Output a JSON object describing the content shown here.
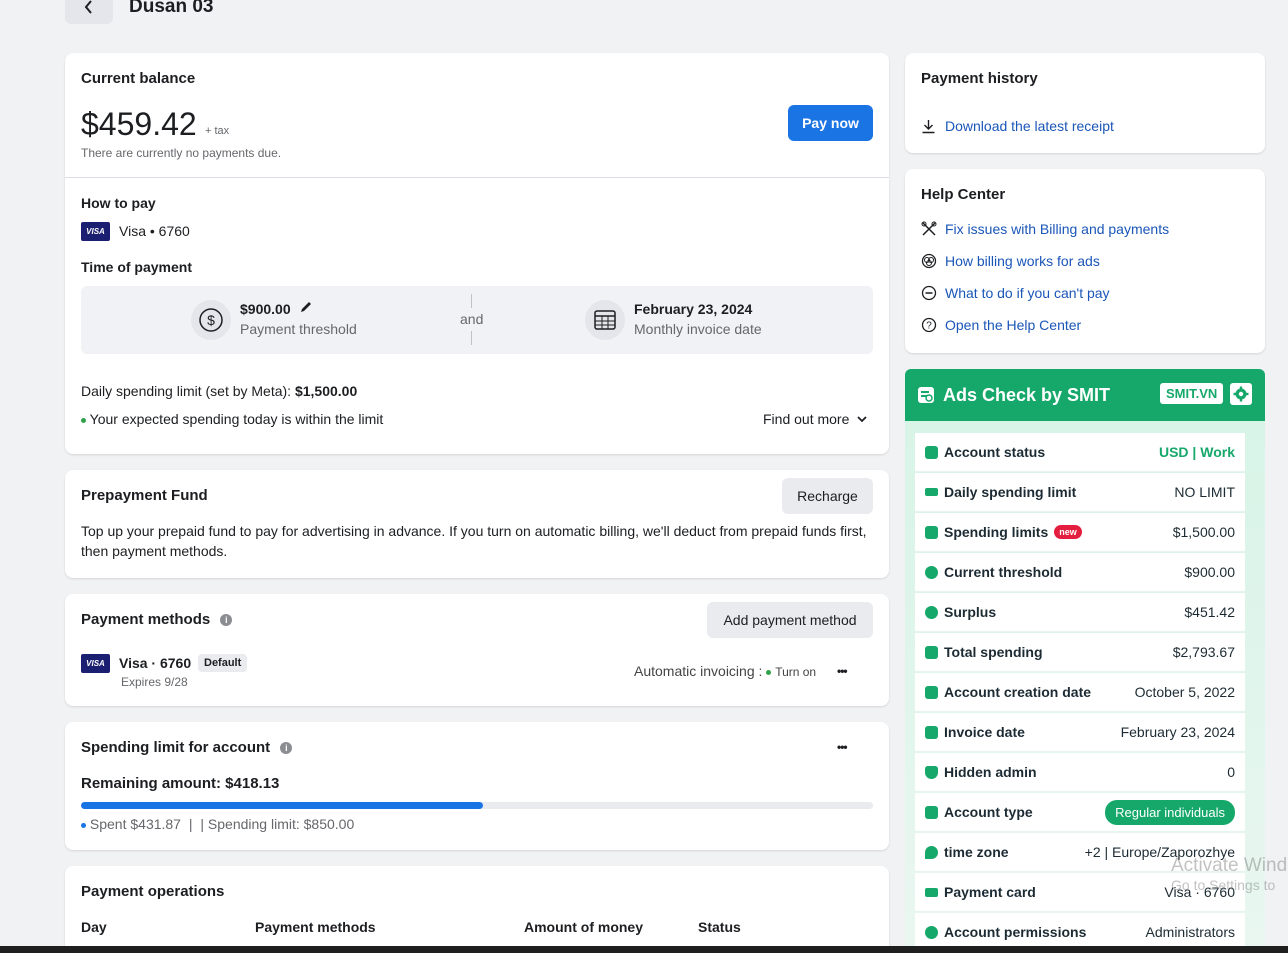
{
  "header": {
    "title": "Dusan 03",
    "back_icon": "chevron-left-icon"
  },
  "balance": {
    "heading": "Current balance",
    "amount": "$459.42",
    "tax": "+ tax",
    "note": "There are currently no payments due.",
    "pay_label": "Pay now",
    "how_to_pay_heading": "How to pay",
    "card_brand": "VISA",
    "card_label": "Visa • 6760",
    "time_heading": "Time of payment",
    "threshold_value": "$900.00",
    "threshold_label": "Payment threshold",
    "and_label": "and",
    "invoice_date_value": "February 23, 2024",
    "invoice_date_label": "Monthly invoice date",
    "daily_limit_text": "Daily spending limit (set by Meta):",
    "daily_limit_value": "$1,500.00",
    "expected_text": "Your expected spending today is within the limit",
    "find_more": "Find out more"
  },
  "prepayment": {
    "heading": "Prepayment Fund",
    "recharge": "Recharge",
    "description": "Top up your prepaid fund to pay for advertising in advance. If you turn on automatic billing, we'll deduct from prepaid funds first, then payment methods."
  },
  "payment_methods": {
    "heading": "Payment methods",
    "add_label": "Add payment method",
    "card_brand": "VISA",
    "card_label": "Visa · 6760",
    "default_badge": "Default",
    "expires": "Expires 9/28",
    "auto_invoicing": "Automatic invoicing :",
    "turn_on": "Turn on",
    "more": "•••"
  },
  "spending_limit": {
    "heading": "Spending limit for account",
    "more": "•••",
    "remaining": "Remaining amount: $418.13",
    "spent": "Spent $431.87",
    "sep": "|",
    "limit": "| Spending limit: $850.00",
    "progress_fraction": 0.508,
    "progress_color": "#1b74e4"
  },
  "operations": {
    "heading": "Payment operations",
    "columns": [
      "Day",
      "Payment methods",
      "Amount of money",
      "Status"
    ]
  },
  "payment_history": {
    "heading": "Payment history",
    "download": "Download the latest receipt",
    "download_icon": "download-icon"
  },
  "help_center": {
    "heading": "Help Center",
    "items": [
      {
        "label": "Fix issues with Billing and payments",
        "icon": "tools-icon"
      },
      {
        "label": "How billing works for ads",
        "icon": "coins-icon"
      },
      {
        "label": "What to do if you can't pay",
        "icon": "minus-circle-icon"
      },
      {
        "label": "Open the Help Center",
        "icon": "question-circle-icon"
      }
    ]
  },
  "smit": {
    "title": "Ads Check by SMIT",
    "badge": "SMIT.VN",
    "accent": "#16a86a",
    "rows": [
      {
        "label": "Account status",
        "value": "USD | Work"
      },
      {
        "label": "Daily spending limit",
        "value": "NO LIMIT"
      },
      {
        "label": "Spending limits",
        "value": "$1,500.00",
        "tag": "new"
      },
      {
        "label": "Current threshold",
        "value": "$900.00"
      },
      {
        "label": "Surplus",
        "value": "$451.42"
      },
      {
        "label": "Total spending",
        "value": "$2,793.67"
      },
      {
        "label": "Account creation date",
        "value": "October 5, 2022"
      },
      {
        "label": "Invoice date",
        "value": "February 23, 2024"
      },
      {
        "label": "Hidden admin",
        "value": "0"
      },
      {
        "label": "Account type",
        "value": "Regular individuals"
      },
      {
        "label": "time zone",
        "value": "+2 | Europe/Zaporozhye"
      },
      {
        "label": "Payment card",
        "value": "Visa · 6760"
      },
      {
        "label": "Account permissions",
        "value": "Administrators"
      }
    ]
  },
  "watermark": {
    "line1": "Activate Wind",
    "line2": "Go to Settings to"
  }
}
